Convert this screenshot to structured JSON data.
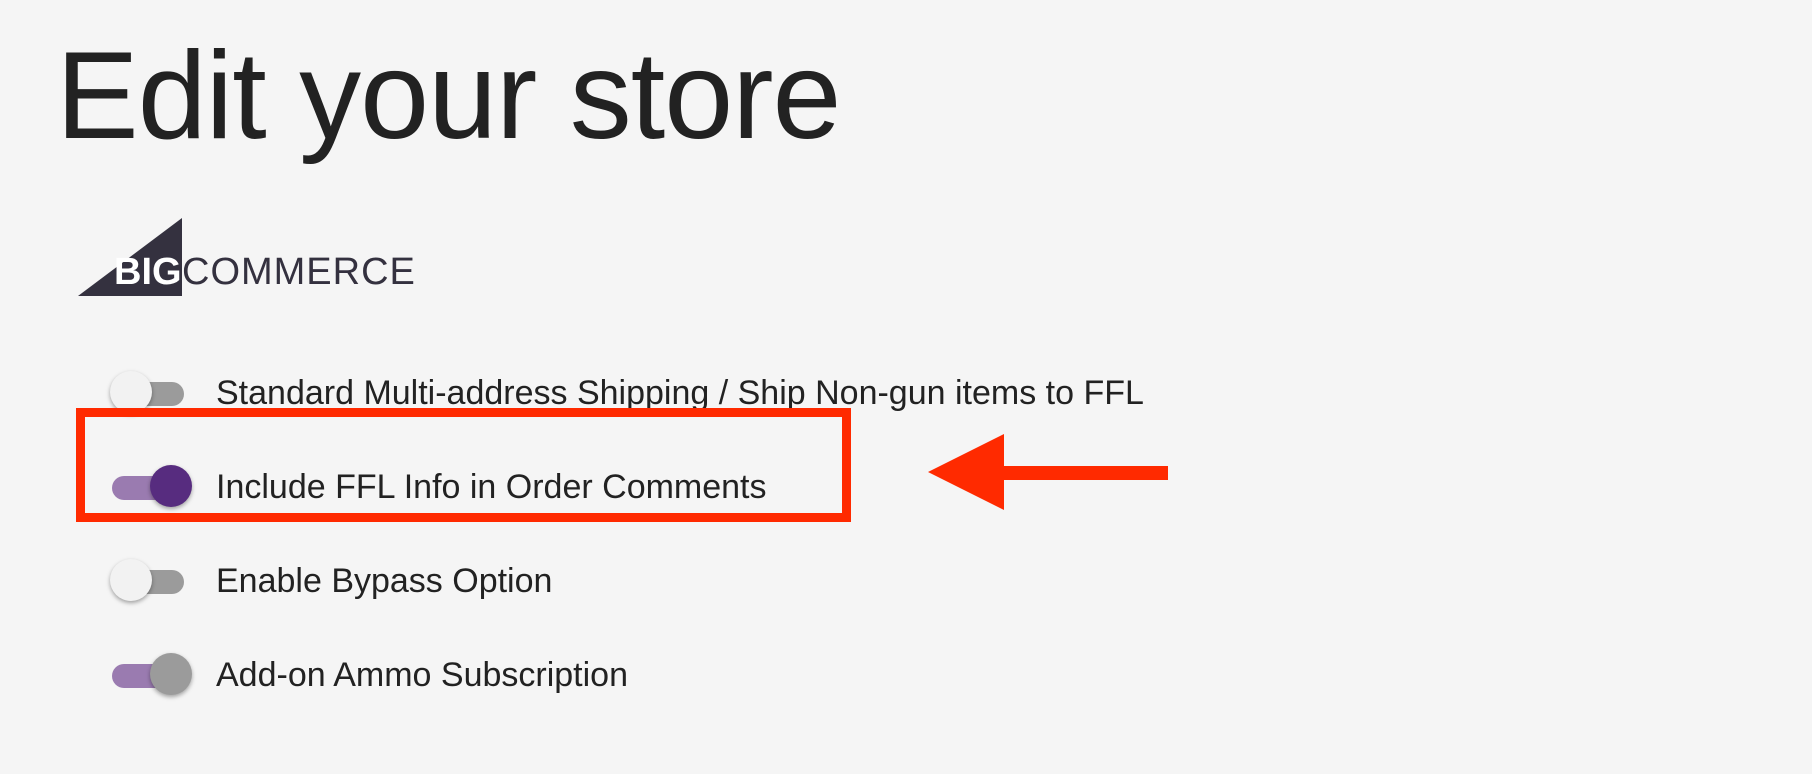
{
  "page": {
    "title": "Edit your store"
  },
  "logo": {
    "name": "bigcommerce-logo",
    "text_bold": "BIG",
    "text_regular": "COMMERCE",
    "mark_color": "#34313f"
  },
  "settings": [
    {
      "label": "Standard Multi-address Shipping / Ship Non-gun items to FFL",
      "state": "off"
    },
    {
      "label": "Include FFL Info in Order Comments",
      "state": "on",
      "highlighted": true
    },
    {
      "label": "Enable Bypass Option",
      "state": "off"
    },
    {
      "label": "Add-on Ammo Subscription",
      "state": "on-disabled"
    }
  ],
  "annotation": {
    "highlight_color": "#ff2a00",
    "arrow_icon": "left-arrow-icon"
  },
  "colors": {
    "background": "#f5f5f5",
    "toggle_active": "#572c7f",
    "toggle_active_track": "#9a7bb0",
    "toggle_off_track": "#9b9b9b",
    "text": "#222222"
  }
}
